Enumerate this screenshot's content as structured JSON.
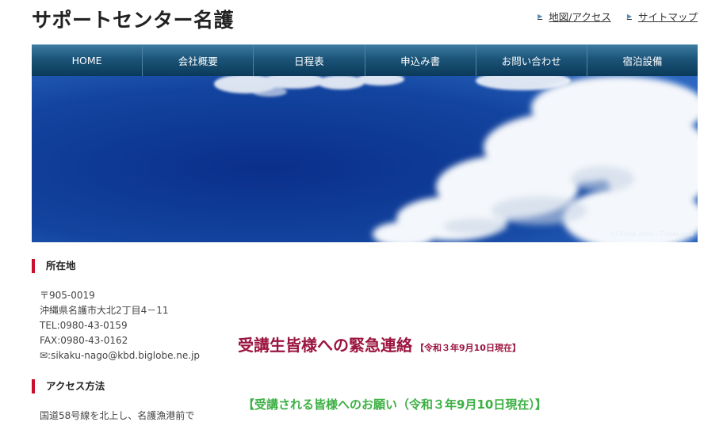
{
  "header": {
    "site_title": "サポートセンター名護",
    "links": [
      {
        "label": "地図/アクセス"
      },
      {
        "label": "サイトマップ"
      }
    ]
  },
  "nav": {
    "items": [
      {
        "label": "HOME"
      },
      {
        "label": "会社概要"
      },
      {
        "label": "日程表"
      },
      {
        "label": "申込み書"
      },
      {
        "label": "お問い合わせ"
      },
      {
        "label": "宿泊設備"
      }
    ]
  },
  "hero": {
    "credit": "(c) Bruce Jones - Fotolia.com",
    "sky_color": "#0e3a9a"
  },
  "sidebar": {
    "location_heading": "所在地",
    "postal": "〒905-0019",
    "address": "沖縄県名護市大北2丁目4－11",
    "tel": "TEL:0980-43-0159",
    "fax": "FAX:0980-43-0162",
    "email": "✉:sikaku-nago@kbd.biglobe.ne.jp",
    "access_heading": "アクセス方法",
    "access_text": "国道58号線を北上し、名護漁港前で"
  },
  "main": {
    "notice_title": "受講生皆様への緊急連絡",
    "notice_date": "【令和３年9月10日現在】",
    "request_heading": "【受講される皆様へのお願い（令和３年9月10日現在）】"
  },
  "colors": {
    "nav": "#1b5478",
    "accent_red": "#c8102e",
    "notice": "#9b1540",
    "request": "#3cb043"
  }
}
